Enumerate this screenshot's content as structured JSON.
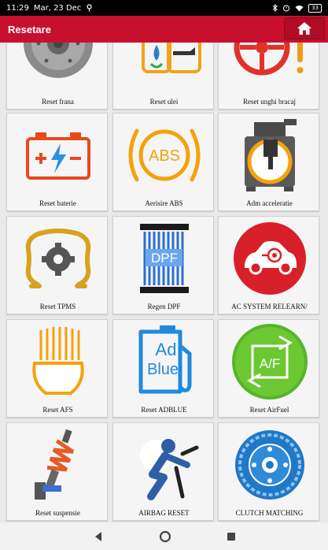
{
  "status": {
    "time": "11:29",
    "date": "Mar, 23 Dec",
    "battery": "33"
  },
  "appbar": {
    "title": "Resetare"
  },
  "tiles": [
    {
      "label": "Reset frana",
      "icon": "brake-disc-icon"
    },
    {
      "label": "Reset ulei",
      "icon": "oil-can-icon"
    },
    {
      "label": "Reset unghi bracaj",
      "icon": "steering-warning-icon"
    },
    {
      "label": "Reset baterie",
      "icon": "battery-icon"
    },
    {
      "label": "Aerisire ABS",
      "icon": "abs-icon"
    },
    {
      "label": "Adm acceleratie",
      "icon": "throttle-body-icon"
    },
    {
      "label": "Reset TPMS",
      "icon": "tpms-icon"
    },
    {
      "label": "Regen DPF",
      "icon": "dpf-icon"
    },
    {
      "label": "AC SYSTEM RELEARN/",
      "icon": "ac-car-icon"
    },
    {
      "label": "Reset AFS",
      "icon": "headlight-icon"
    },
    {
      "label": "Reset ADBLUE",
      "icon": "adblue-icon"
    },
    {
      "label": "Reset AirFuel",
      "icon": "air-fuel-icon"
    },
    {
      "label": "Reset suspensie",
      "icon": "suspension-icon"
    },
    {
      "label": "AIRBAG RESET",
      "icon": "airbag-icon"
    },
    {
      "label": "CLUTCH MATCHING",
      "icon": "clutch-icon"
    }
  ],
  "icon_text": {
    "abs": "ABS",
    "dpf": "DPF",
    "adblue_1": "Ad",
    "adblue_2": "Blue",
    "af": "A/F"
  }
}
